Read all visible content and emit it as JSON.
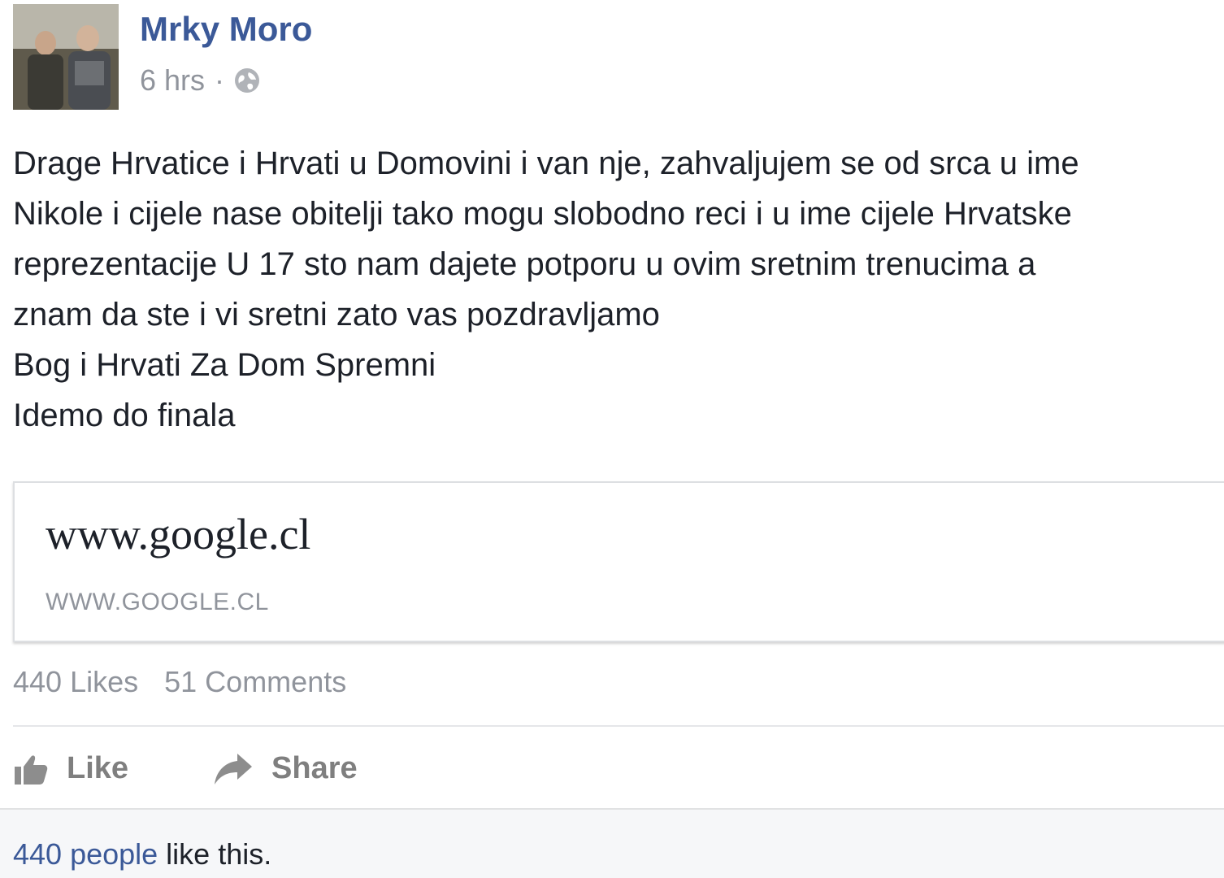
{
  "post": {
    "author": "Mrky Moro",
    "time": "6 hrs",
    "separator": "·",
    "privacy_icon": "globe-icon",
    "body_lines": [
      "Drage Hrvatice i Hrvati u Domovini i van nje, zahvaljujem se od srca u ime",
      "Nikole i cijele nase obitelji tako mogu slobodno reci i u ime cijele Hrvatske",
      "reprezentacije U 17 sto nam dajete potporu u ovim sretnim trenucima a",
      "znam da ste i vi sretni zato vas pozdravljamo",
      "Bog i Hrvati Za Dom Spremni",
      "Idemo do finala"
    ],
    "link": {
      "title": "www.google.cl",
      "domain": "WWW.GOOGLE.CL"
    },
    "counts": {
      "likes": "440 Likes",
      "comments": "51 Comments"
    },
    "actions": {
      "like_label": "Like",
      "like_icon": "thumbs-up-icon",
      "share_label": "Share",
      "share_icon": "share-arrow-icon"
    },
    "likes_summary": {
      "link_text": "440 people",
      "rest_text": " like this."
    }
  },
  "colors": {
    "author": "#3b5998",
    "meta": "#90949c",
    "body": "#1d2129",
    "action": "#7f7f7f",
    "likes_bar_bg": "#f6f7f9"
  }
}
